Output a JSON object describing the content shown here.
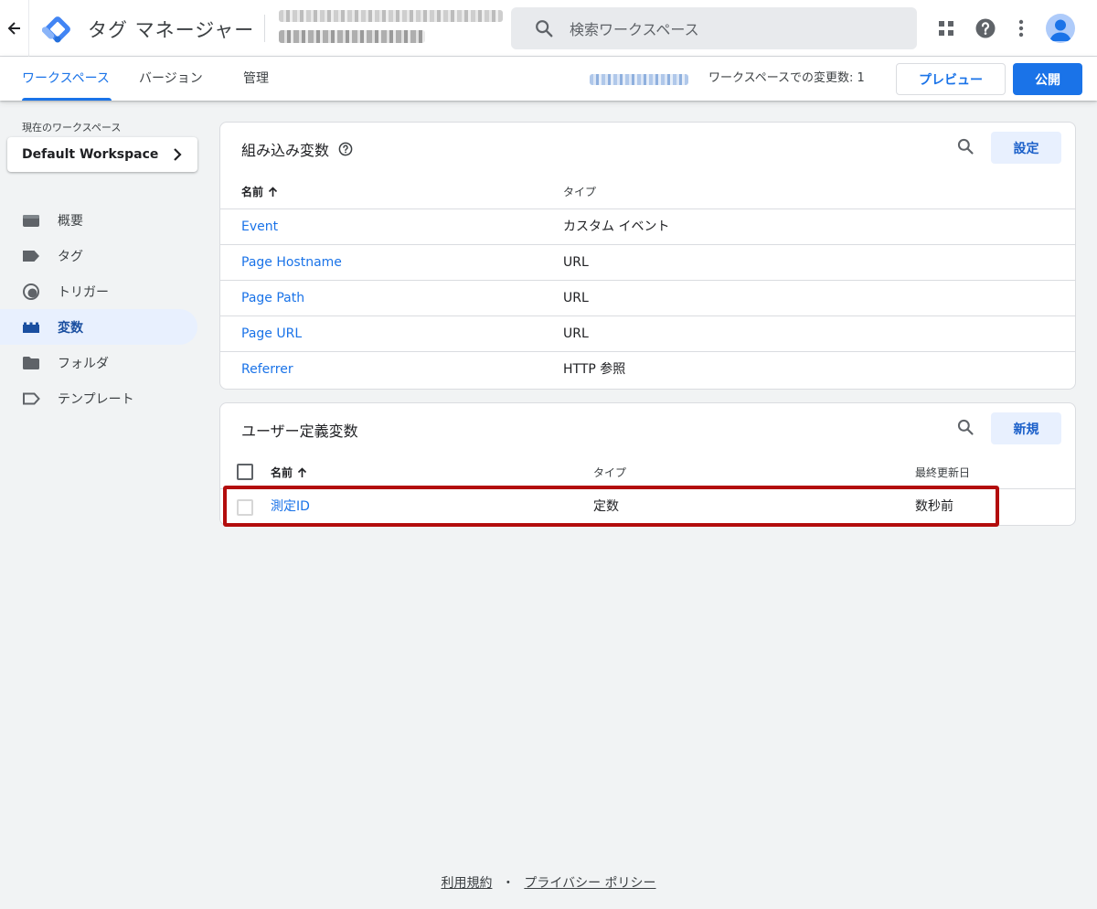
{
  "app": {
    "title": "タグ マネージャー",
    "search_placeholder": "検索ワークスペース",
    "icons": [
      "back-arrow-icon",
      "tag-manager-logo",
      "search-icon",
      "apps-grid-icon",
      "help-icon",
      "more-vert-icon",
      "account-avatar"
    ]
  },
  "tabs": [
    {
      "label": "ワークスペース",
      "active": true
    },
    {
      "label": "バージョン",
      "active": false
    },
    {
      "label": "管理",
      "active": false
    }
  ],
  "toolbar": {
    "changes_label": "ワークスペースでの変更数: 1",
    "preview_label": "プレビュー",
    "publish_label": "公開"
  },
  "sidebar": {
    "workspace_label": "現在のワークスペース",
    "workspace_name": "Default Workspace",
    "items": [
      {
        "label": "概要",
        "icon": "overview-icon",
        "active": false
      },
      {
        "label": "タグ",
        "icon": "tag-icon",
        "active": false
      },
      {
        "label": "トリガー",
        "icon": "trigger-icon",
        "active": false
      },
      {
        "label": "変数",
        "icon": "variables-icon",
        "active": true
      },
      {
        "label": "フォルダ",
        "icon": "folder-icon",
        "active": false
      },
      {
        "label": "テンプレート",
        "icon": "template-icon",
        "active": false
      }
    ]
  },
  "builtin": {
    "title": "組み込み変数",
    "button_label": "設定",
    "columns": [
      "名前",
      "タイプ"
    ],
    "rows": [
      {
        "name": "Event",
        "type": "カスタム イベント"
      },
      {
        "name": "Page Hostname",
        "type": "URL"
      },
      {
        "name": "Page Path",
        "type": "URL"
      },
      {
        "name": "Page URL",
        "type": "URL"
      },
      {
        "name": "Referrer",
        "type": "HTTP 参照"
      }
    ]
  },
  "userdefined": {
    "title": "ユーザー定義変数",
    "button_label": "新規",
    "columns": [
      "名前",
      "タイプ",
      "最終更新日"
    ],
    "rows": [
      {
        "name": "測定ID",
        "type": "定数",
        "updated": "数秒前"
      }
    ]
  },
  "footer": {
    "terms": "利用規約",
    "separator": "・",
    "privacy": "プライバシー ポリシー"
  },
  "colors": {
    "accent": "#1a73e8",
    "highlight": "#b30d0d",
    "active_nav_bg": "#e8f0fe"
  }
}
